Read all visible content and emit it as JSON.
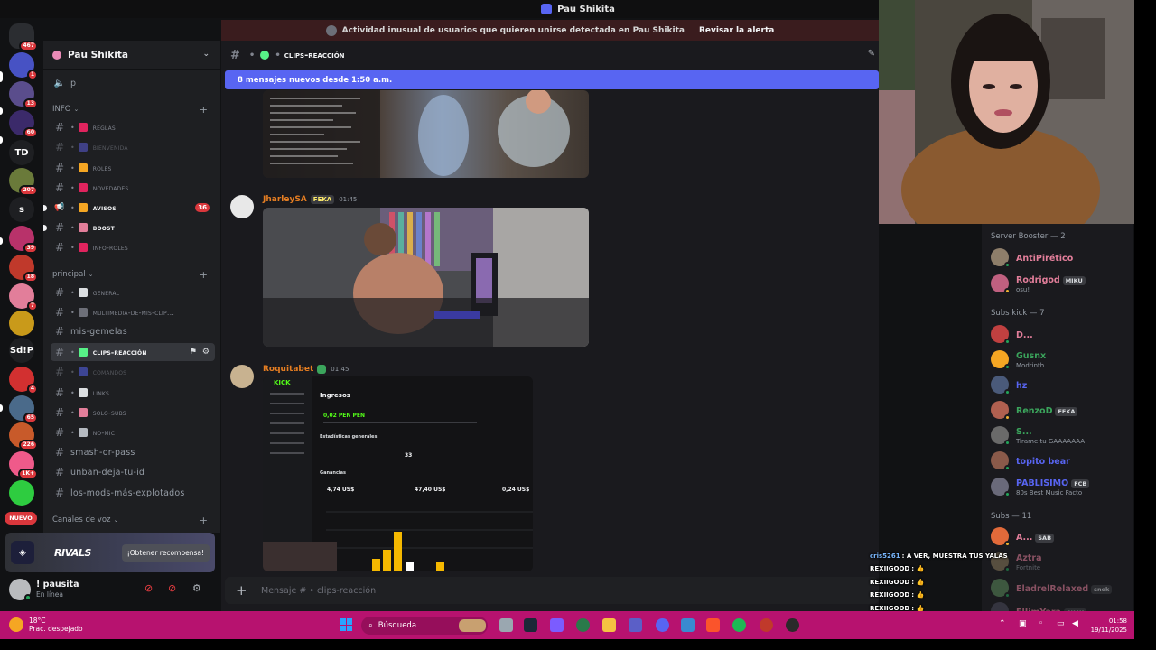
{
  "window": {
    "title": "Pau Shikita"
  },
  "alert": {
    "text": "Actividad inusual de usuarios que quieren unirse detectada en Pau Shikita",
    "link": "Revisar la alerta"
  },
  "rail": {
    "servers": [
      {
        "label": "",
        "badge": "467",
        "color": "#2b2d31",
        "icon": "discord-home-icon"
      },
      {
        "label": "",
        "badge": "1",
        "color": "#4752c4",
        "icon": "server-icon"
      },
      {
        "label": "",
        "badge": "13",
        "color": "#5a4d8c",
        "icon": "server-icon"
      },
      {
        "label": "",
        "badge": "60",
        "color": "#3b2a6a",
        "icon": "server-icon"
      },
      {
        "label": "TD",
        "badge": "",
        "color": "#1e1f22",
        "icon": "server-icon"
      },
      {
        "label": "",
        "badge": "207",
        "color": "#6a7a3a",
        "icon": "server-icon"
      },
      {
        "label": "s",
        "badge": "",
        "color": "#1e1f22",
        "icon": "server-icon"
      },
      {
        "label": "",
        "badge": "39",
        "color": "#b8326a",
        "icon": "server-icon"
      },
      {
        "label": "",
        "badge": "18",
        "color": "#c0392b",
        "icon": "server-icon"
      },
      {
        "label": "",
        "badge": "7",
        "color": "#e27e9a",
        "icon": "server-icon"
      },
      {
        "label": "",
        "badge": "",
        "color": "#c99a1a",
        "icon": "crown-icon"
      },
      {
        "label": "Sd!P",
        "badge": "",
        "color": "#1e1f22",
        "icon": "server-icon"
      },
      {
        "label": "",
        "badge": "4",
        "color": "#d23030",
        "icon": "server-icon"
      },
      {
        "label": "",
        "badge": "65",
        "color": "#4a6a8a",
        "icon": "server-icon"
      },
      {
        "label": "",
        "badge": "226",
        "color": "#c85a2a",
        "icon": "server-icon"
      },
      {
        "label": "",
        "badge": "1K+",
        "color": "#ef5a8a",
        "icon": "server-icon"
      },
      {
        "label": "",
        "badge": "",
        "color": "#2ecc40",
        "icon": "creeper-icon"
      }
    ],
    "new_label": "NUEVO"
  },
  "sidebar": {
    "guild_name": "Pau Shikita",
    "top_item": "p",
    "categories": {
      "info": "INFO",
      "principal": "principal",
      "voz": "Canales de voz"
    },
    "channels": [
      {
        "name": "reglas",
        "emoji_color": "#e0245e",
        "style": "dim"
      },
      {
        "name": "bienvenida",
        "emoji_color": "#5b5bd6",
        "style": "faded"
      },
      {
        "name": "roles",
        "emoji_color": "#f5a623",
        "style": "dim"
      },
      {
        "name": "novedades",
        "emoji_color": "#e0245e",
        "style": "dim"
      },
      {
        "name": "avisos",
        "emoji_color": "#f5a623",
        "style": "bold",
        "badge": "36"
      },
      {
        "name": "boost",
        "emoji_color": "#e27e9a",
        "style": "bold"
      },
      {
        "name": "info-roles",
        "emoji_color": "#e0245e",
        "style": "dim"
      },
      {
        "name": "general",
        "emoji_color": "#dbdee1",
        "style": "dim"
      },
      {
        "name": "multimedia-de-mis-clip...",
        "emoji_color": "#6d6f78",
        "style": "dim"
      },
      {
        "name": "mis-gemelas",
        "emoji_color": "",
        "style": "plain"
      },
      {
        "name": "clips-reacción",
        "emoji_color": "#57f287",
        "style": "active"
      },
      {
        "name": "comandos",
        "emoji_color": "#5865f2",
        "style": "faded"
      },
      {
        "name": "links",
        "emoji_color": "#dbdee1",
        "style": "dim"
      },
      {
        "name": "solo-subs",
        "emoji_color": "#e27e9a",
        "style": "dim"
      },
      {
        "name": "no-mic",
        "emoji_color": "#b5bac1",
        "style": "dim"
      },
      {
        "name": "smash-or-pass",
        "emoji_color": "",
        "style": "plain"
      },
      {
        "name": "unban-deja-tu-id",
        "emoji_color": "",
        "style": "plain"
      },
      {
        "name": "los-mods-más-explotados",
        "emoji_color": "",
        "style": "plain"
      }
    ]
  },
  "promo": {
    "title": "RIVALS",
    "button": "¡Obtener recompensa!"
  },
  "user": {
    "name": "! pausita",
    "status": "En línea"
  },
  "chat": {
    "channel_name": "clips-reacción",
    "new_messages": "8 mensajes nuevos desde 1:50 a.m.",
    "messages": [
      {
        "author": "JharleySA",
        "author_color": "#e67e22",
        "tag": "FEKA",
        "time": "01:45"
      },
      {
        "author": "Roquitabet",
        "author_color": "#e67e22",
        "tag": "",
        "time": "01:45"
      }
    ],
    "dashboard": {
      "brand": "KICK",
      "heading": "Ingresos",
      "amount": "0,02 PEN PEN",
      "section": "Estadísticas generales",
      "subs_count": "33",
      "earnings_label": "Ganancias",
      "earnings": [
        "4,74 US$",
        "47,40 US$",
        "0,24 US$"
      ]
    },
    "composer_placeholder": "Mensaje #  •  clips-reacción"
  },
  "members": {
    "groups": [
      {
        "title": "Server Booster — 2"
      },
      {
        "title": "Subs kick — 7"
      },
      {
        "title": "Subs — 11"
      }
    ],
    "list": [
      {
        "name": "AntiPirético",
        "sub": "",
        "tag": "",
        "color": "#e27e9a",
        "av": "#8e7e6a"
      },
      {
        "name": "Rodrigod",
        "sub": "osu!",
        "tag": "MIKU",
        "color": "#e27e9a",
        "av": "#c06080"
      },
      {
        "name": "D...",
        "sub": "",
        "tag": "",
        "color": "#e27e9a",
        "av": "#c04040"
      },
      {
        "name": "Gusnx",
        "sub": "Modrinth",
        "tag": "",
        "color": "#3ba55c",
        "av": "#f5a623"
      },
      {
        "name": "hz",
        "sub": "",
        "tag": "",
        "color": "#5865f2",
        "av": "#4a5a7a"
      },
      {
        "name": "RenzoD",
        "sub": "",
        "tag": "FEKA",
        "color": "#3ba55c",
        "av": "#b06050"
      },
      {
        "name": "S...",
        "sub": "Tirame tu GAAAAAAA",
        "tag": "",
        "color": "#3ba55c",
        "av": "#6a6a6a"
      },
      {
        "name": "topito bear",
        "sub": "",
        "tag": "",
        "color": "#5865f2",
        "av": "#8a5a4a"
      },
      {
        "name": "PABLISIMO",
        "sub": "80s Best Music Facto",
        "tag": "FCB",
        "color": "#5865f2",
        "av": "#6a6a7a"
      },
      {
        "name": "A...",
        "sub": "",
        "tag": "SAB",
        "color": "#e27e9a",
        "av": "#e26a3a"
      },
      {
        "name": "Aztra",
        "sub": "Fortnite",
        "tag": "",
        "color": "#e27e9a",
        "av": "#8a7a5a"
      },
      {
        "name": "EladrelRelaxed",
        "sub": "",
        "tag": "snek",
        "color": "#e27e9a",
        "av": "#5a8a5a"
      },
      {
        "name": "ElJimYara",
        "sub": "",
        "tag": "4K4K",
        "color": "#e27e9a",
        "av": "#4a4a5a"
      }
    ]
  },
  "stream_chat": [
    {
      "user": "cris5261",
      "text": ": A VER, MUESTRA TUS YALAS"
    },
    {
      "user": "REXIIGOOD",
      "text": ": 👍"
    },
    {
      "user": "REXIIGOOD",
      "text": ": 👍"
    },
    {
      "user": "REXIIGOOD",
      "text": ": 👍"
    },
    {
      "user": "REXIIGOOD",
      "text": ": 👍"
    },
    {
      "user": "REXIIGOOD",
      "text": ": 👍"
    }
  ],
  "taskbar": {
    "weather_temp": "18°C",
    "weather_desc": "Prac. despejado",
    "search": "Búsqueda",
    "time": "01:58",
    "date": "19/11/2025"
  }
}
